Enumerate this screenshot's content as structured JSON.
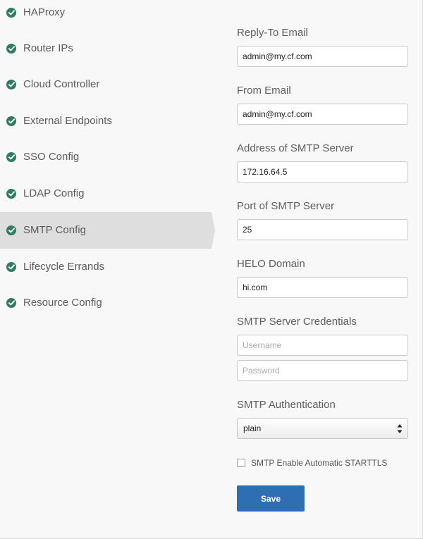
{
  "sidebar": {
    "items": [
      {
        "label": "HAProxy",
        "icon": "check-circle-icon",
        "active": false
      },
      {
        "label": "Router IPs",
        "icon": "check-circle-icon",
        "active": false
      },
      {
        "label": "Cloud Controller",
        "icon": "check-circle-icon",
        "active": false
      },
      {
        "label": "External Endpoints",
        "icon": "check-circle-icon",
        "active": false
      },
      {
        "label": "SSO Config",
        "icon": "check-circle-icon",
        "active": false
      },
      {
        "label": "LDAP Config",
        "icon": "check-circle-icon",
        "active": false
      },
      {
        "label": "SMTP Config",
        "icon": "check-circle-icon",
        "active": true
      },
      {
        "label": "Lifecycle Errands",
        "icon": "check-circle-icon",
        "active": false
      },
      {
        "label": "Resource Config",
        "icon": "check-circle-icon",
        "active": false
      }
    ]
  },
  "form": {
    "reply_to_email": {
      "label": "Reply-To Email",
      "value": "admin@my.cf.com"
    },
    "from_email": {
      "label": "From Email",
      "value": "admin@my.cf.com"
    },
    "smtp_address": {
      "label": "Address of SMTP Server",
      "value": "172.16.64.5"
    },
    "smtp_port": {
      "label": "Port of SMTP Server",
      "value": "25"
    },
    "helo_domain": {
      "label": "HELO Domain",
      "value": "hi.com"
    },
    "credentials": {
      "label": "SMTP Server Credentials",
      "username_placeholder": "Username",
      "username_value": "",
      "password_placeholder": "Password",
      "password_value": ""
    },
    "smtp_auth": {
      "label": "SMTP Authentication",
      "selected": "plain"
    },
    "starttls": {
      "label": "SMTP Enable Automatic STARTTLS",
      "checked": false
    },
    "save_label": "Save"
  },
  "colors": {
    "check_green": "#2f7b66",
    "active_bg": "#dedede",
    "save_blue": "#2e6fb4",
    "page_bg": "#f8f8f8"
  }
}
